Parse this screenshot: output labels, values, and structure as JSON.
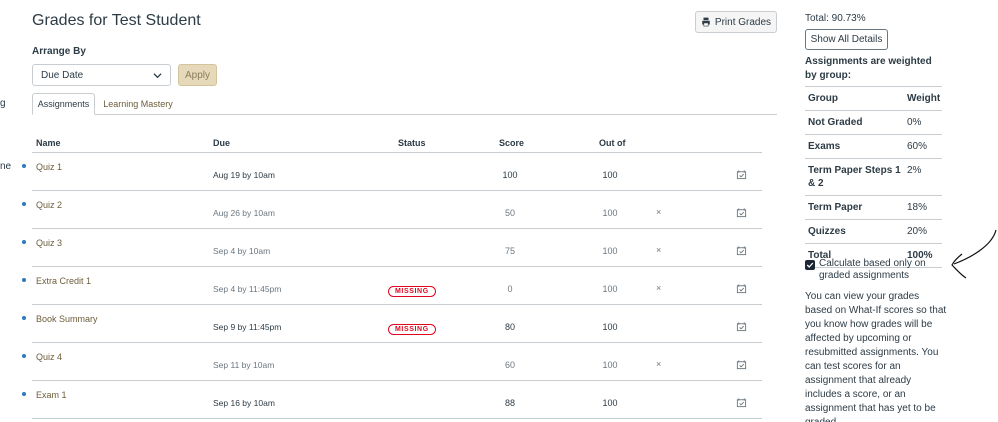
{
  "left_edge": {
    "fragment_1": "g",
    "fragment_2": "ne"
  },
  "header": {
    "title": "Grades for Test Student",
    "print_label": "Print Grades",
    "print_icon": "printer-icon"
  },
  "arrange": {
    "label": "Arrange By",
    "selected": "Due Date",
    "apply_label": "Apply"
  },
  "tabs": [
    {
      "label": "Assignments",
      "active": true
    },
    {
      "label": "Learning Mastery",
      "active": false
    }
  ],
  "table": {
    "headers": {
      "name": "Name",
      "due": "Due",
      "status": "Status",
      "score": "Score",
      "out_of": "Out of"
    },
    "rows": [
      {
        "name": "Quiz 1",
        "due": "Aug 19 by 10am",
        "status": "",
        "score": "100",
        "out_of": "100",
        "x": ""
      },
      {
        "name": "Quiz 2",
        "due": "Aug 26 by 10am",
        "status": "",
        "score": "50",
        "out_of": "100",
        "x": "×"
      },
      {
        "name": "Quiz 3",
        "due": "Sep 4 by 10am",
        "status": "",
        "score": "75",
        "out_of": "100",
        "x": "×"
      },
      {
        "name": "Extra Credit 1",
        "due": "Sep 4 by 11:45pm",
        "status": "MISSING",
        "score": "0",
        "out_of": "100",
        "x": "×"
      },
      {
        "name": "Book Summary",
        "due": "Sep 9 by 11:45pm",
        "status": "MISSING",
        "score": "80",
        "out_of": "100",
        "x": ""
      },
      {
        "name": "Quiz 4",
        "due": "Sep 11 by 10am",
        "status": "",
        "score": "60",
        "out_of": "100",
        "x": "×"
      },
      {
        "name": "Exam 1",
        "due": "Sep 16 by 10am",
        "status": "",
        "score": "88",
        "out_of": "100",
        "x": ""
      }
    ]
  },
  "sidebar": {
    "total": "Total: 90.73%",
    "show_details": "Show All Details",
    "weighted_heading": "Assignments are weighted by group:",
    "weights_header": {
      "group": "Group",
      "weight": "Weight"
    },
    "weights": [
      {
        "group": "Not Graded",
        "weight": "0%"
      },
      {
        "group": "Exams",
        "weight": "60%"
      },
      {
        "group": "Term Paper Steps 1 & 2",
        "weight": "2%"
      },
      {
        "group": "Term Paper",
        "weight": "18%"
      },
      {
        "group": "Quizzes",
        "weight": "20%"
      },
      {
        "group": "Total",
        "weight": "100%"
      }
    ],
    "calc_checkbox_label": "Calculate based only on graded assignments",
    "calc_checked": true,
    "what_if_text": "You can view your grades based on What-If scores so that you know how grades will be affected by upcoming or resubmitted assignments. You can test scores for an assignment that already includes a score, or an assignment that has yet to be graded."
  },
  "colors": {
    "accent_link": "#6d5d3a",
    "missing_red": "#e0061f",
    "unread_dot": "#2b7abc",
    "apply_bg": "#e5d9b9"
  }
}
